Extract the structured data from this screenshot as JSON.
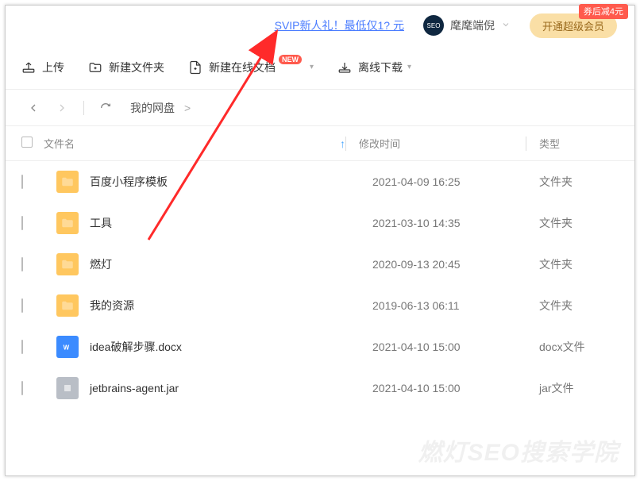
{
  "header": {
    "promo_text": "SVIP新人礼！最低仅1? 元",
    "avatar_text": "SEO",
    "user_name": "麾麾端倪",
    "vip_button": "开通超级会员",
    "vip_badge": "券后减4元"
  },
  "toolbar": {
    "upload": "上传",
    "new_folder": "新建文件夹",
    "new_doc": "新建在线文档",
    "new_doc_badge": "NEW",
    "offline_download": "离线下载"
  },
  "breadcrumb": {
    "location": "我的网盘",
    "sep": ">"
  },
  "table": {
    "columns": {
      "name": "文件名",
      "modified": "修改时间",
      "type": "类型"
    }
  },
  "files": [
    {
      "icon": "folder",
      "name": "百度小程序模板",
      "modified": "2021-04-09 16:25",
      "type": "文件夹"
    },
    {
      "icon": "folder",
      "name": "工具",
      "modified": "2021-03-10 14:35",
      "type": "文件夹"
    },
    {
      "icon": "folder",
      "name": "燃灯",
      "modified": "2020-09-13 20:45",
      "type": "文件夹"
    },
    {
      "icon": "folder",
      "name": "我的资源",
      "modified": "2019-06-13 06:11",
      "type": "文件夹"
    },
    {
      "icon": "docx",
      "name": "idea破解步骤.docx",
      "modified": "2021-04-10 15:00",
      "type": "docx文件"
    },
    {
      "icon": "jar",
      "name": "jetbrains-agent.jar",
      "modified": "2021-04-10 15:00",
      "type": "jar文件"
    }
  ],
  "watermark": "燃灯SEO搜索学院"
}
